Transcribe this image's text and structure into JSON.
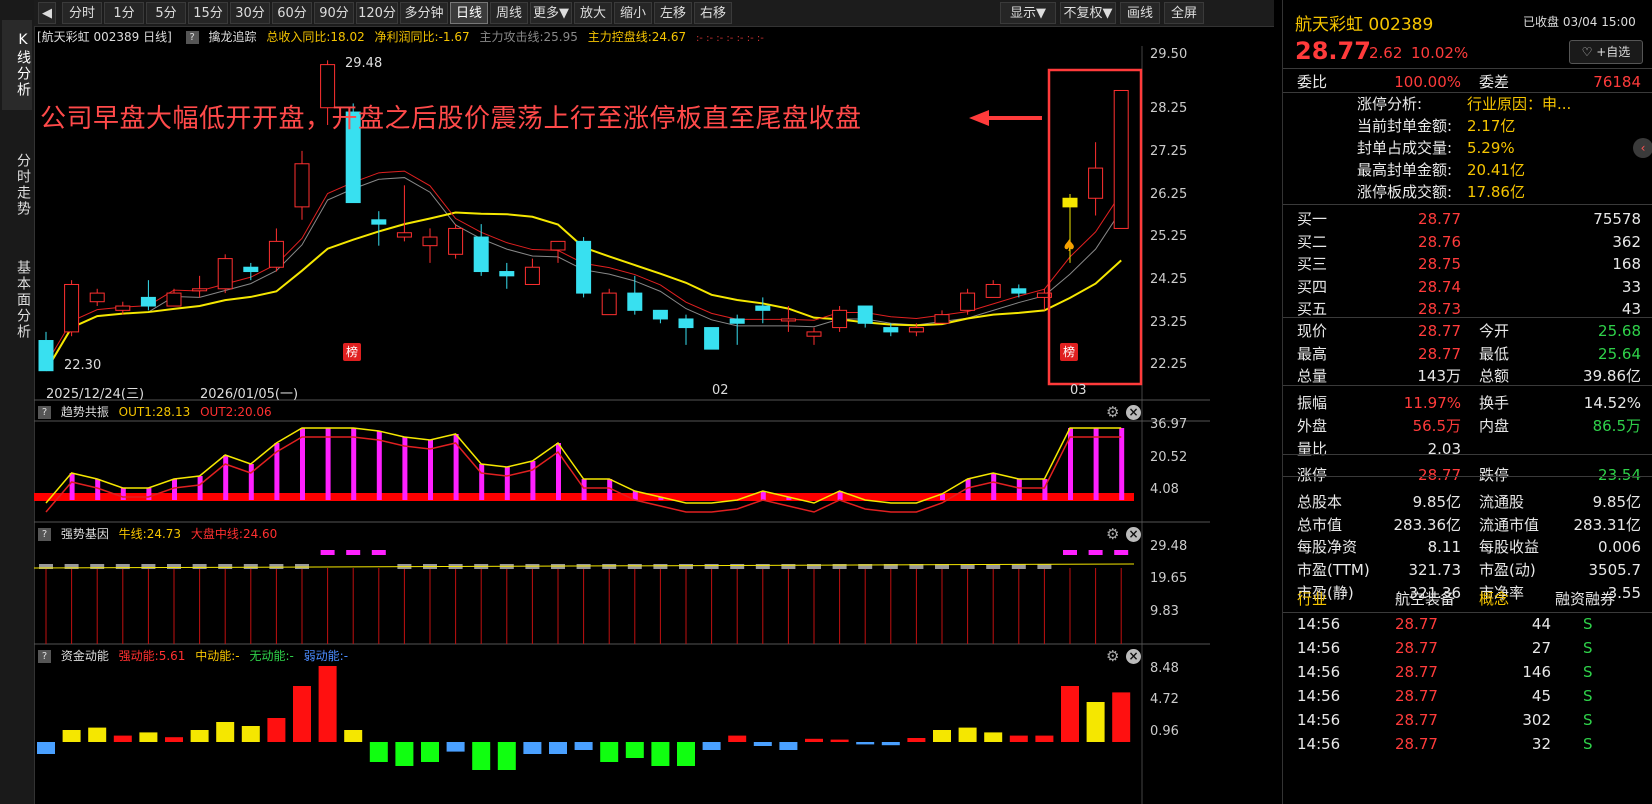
{
  "left_tabs": [
    "K线分析",
    "分时走势",
    "基本面分析"
  ],
  "toolbar": {
    "back_icon": "collapse-left-icon",
    "periods": [
      "分时",
      "1分",
      "5分",
      "15分",
      "30分",
      "60分",
      "90分",
      "120分",
      "多分钟",
      "日线",
      "周线",
      "更多▼",
      "放大",
      "缩小",
      "左移",
      "右移"
    ],
    "active_period": "日线",
    "right": [
      "显示▼",
      "不复权▼",
      "画线",
      "全屏"
    ]
  },
  "main_chart": {
    "title": "[航天彩虹 002389 日线]",
    "indicator_name": "擒龙追踪",
    "ind1": "总收入同比:18.02",
    "ind2": "净利润同比:-1.67",
    "ind3": "主力攻击线:25.95",
    "ind4": "主力控盘线:24.67",
    "ind_dots": ":-  :-  :-  :-  :-  :-  :-",
    "y_ticks": [
      "29.50",
      "28.25",
      "27.25",
      "26.25",
      "25.25",
      "24.25",
      "23.25",
      "22.25"
    ],
    "high_label": "29.48",
    "low_label": "22.30",
    "annotation": "公司早盘大幅低开开盘，开盘之后股价震荡上行至涨停板直至尾盘收盘",
    "badge": "榜",
    "x_labels": [
      "2025/12/24(三)",
      "2026/01/05(一)",
      "02",
      "03"
    ]
  },
  "panel2": {
    "name": "趋势共振",
    "out1": "OUT1:28.13",
    "out2": "OUT2:20.06",
    "y_ticks": [
      "36.97",
      "20.52",
      "4.08"
    ]
  },
  "panel3": {
    "name": "强势基因",
    "l1": "牛线:24.73",
    "l2": "大盘中线:24.60",
    "y_ticks": [
      "29.48",
      "19.65",
      "9.83"
    ]
  },
  "panel4": {
    "name": "资金动能",
    "l1": "强动能:5.61",
    "l2": "中动能:-",
    "l3": "无动能:-",
    "l4": "弱动能:-",
    "y_ticks": [
      "8.48",
      "4.72",
      "0.96"
    ]
  },
  "candles": [
    [
      23.0,
      22.3,
      22.9,
      23.2
    ],
    [
      23.2,
      24.3,
      23.1,
      24.4
    ],
    [
      23.9,
      24.1,
      23.8,
      24.2
    ],
    [
      23.7,
      23.8,
      23.6,
      23.9
    ],
    [
      24.0,
      23.8,
      23.7,
      24.4
    ],
    [
      23.8,
      24.1,
      23.8,
      24.2
    ],
    [
      24.2,
      24.2,
      24.0,
      24.5
    ],
    [
      24.2,
      24.9,
      24.1,
      25.0
    ],
    [
      24.7,
      24.6,
      24.4,
      24.8
    ],
    [
      24.7,
      25.3,
      24.6,
      25.6
    ],
    [
      26.1,
      27.1,
      25.8,
      27.4
    ],
    [
      28.4,
      29.4,
      28.0,
      29.5
    ],
    [
      28.3,
      26.2,
      26.2,
      28.5
    ],
    [
      25.8,
      25.7,
      25.2,
      26.0
    ],
    [
      25.4,
      25.5,
      25.3,
      26.6
    ],
    [
      25.2,
      25.4,
      24.8,
      25.6
    ],
    [
      25.0,
      25.6,
      24.9,
      25.7
    ],
    [
      25.4,
      24.6,
      24.5,
      25.7
    ],
    [
      24.6,
      24.5,
      24.2,
      24.8
    ],
    [
      24.3,
      24.7,
      24.3,
      24.9
    ],
    [
      25.1,
      25.3,
      24.8,
      25.3
    ],
    [
      25.3,
      24.1,
      24.0,
      25.4
    ],
    [
      23.6,
      24.1,
      23.6,
      24.2
    ],
    [
      24.1,
      23.7,
      23.6,
      24.5
    ],
    [
      23.7,
      23.5,
      23.4,
      23.7
    ],
    [
      23.5,
      23.3,
      22.9,
      23.6
    ],
    [
      23.3,
      22.8,
      22.8,
      23.3
    ],
    [
      23.5,
      23.4,
      22.9,
      23.6
    ],
    [
      23.8,
      23.7,
      23.4,
      24.0
    ],
    [
      23.5,
      23.5,
      23.2,
      23.8
    ],
    [
      23.1,
      23.2,
      22.9,
      23.3
    ],
    [
      23.3,
      23.7,
      23.2,
      23.8
    ],
    [
      23.8,
      23.4,
      23.3,
      23.8
    ],
    [
      23.3,
      23.2,
      23.1,
      23.4
    ],
    [
      23.2,
      23.3,
      23.1,
      23.4
    ],
    [
      23.4,
      23.6,
      23.4,
      23.7
    ],
    [
      23.7,
      24.1,
      23.6,
      24.2
    ],
    [
      24.0,
      24.3,
      24.0,
      24.4
    ],
    [
      24.2,
      24.1,
      24.0,
      24.3
    ],
    [
      24.0,
      24.1,
      23.7,
      24.2
    ],
    [
      26.3,
      26.1,
      24.8,
      26.4
    ],
    [
      26.3,
      27.0,
      25.9,
      27.6
    ],
    [
      25.6,
      28.8,
      25.6,
      28.8
    ]
  ],
  "right_panel": {
    "stock_name": "航天彩虹 002389",
    "status": "已收盘 03/04 15:00",
    "price": "28.77",
    "change": "2.62",
    "pct": "10.02%",
    "watch_btn": "♡ +自选",
    "weibi_label": "委比",
    "weibi": "100.00%",
    "weicha_label": "委差",
    "weicha": "76184",
    "limit_info": [
      [
        "涨停分析:",
        "行业原因：申..."
      ],
      [
        "当前封单金额:",
        "2.17亿"
      ],
      [
        "封单占成交量:",
        "5.29%"
      ],
      [
        "最高封单金额:",
        "20.41亿"
      ],
      [
        "涨停板成交额:",
        "17.86亿"
      ]
    ],
    "bids": [
      [
        "买一",
        "28.77",
        "75578"
      ],
      [
        "买二",
        "28.76",
        "362"
      ],
      [
        "买三",
        "28.75",
        "168"
      ],
      [
        "买四",
        "28.74",
        "33"
      ],
      [
        "买五",
        "28.73",
        "43"
      ]
    ],
    "stats": [
      [
        "现价",
        "28.77",
        "今开",
        "25.68"
      ],
      [
        "最高",
        "28.77",
        "最低",
        "25.64"
      ],
      [
        "总量",
        "143万",
        "总额",
        "39.86亿"
      ],
      [
        "振幅",
        "11.97%",
        "换手",
        "14.52%"
      ],
      [
        "外盘",
        "56.5万",
        "内盘",
        "86.5万"
      ],
      [
        "量比",
        "2.03",
        "",
        ""
      ],
      [
        "涨停",
        "28.77",
        "跌停",
        "23.54"
      ],
      [
        "总股本",
        "9.85亿",
        "流通股",
        "9.85亿"
      ],
      [
        "总市值",
        "283.36亿",
        "流通市值",
        "283.31亿"
      ],
      [
        "每股净资",
        "8.11",
        "每股收益",
        "0.006"
      ],
      [
        "市盈(TTM)",
        "321.73",
        "市盈(动)",
        "3505.7"
      ],
      [
        "市盈(静)",
        "321.36",
        "市净率",
        "3.55"
      ]
    ],
    "tags": [
      "行业",
      "航空装备",
      "概念",
      "融资融券"
    ],
    "ticks": [
      [
        "14:56",
        "28.77",
        "44",
        "S"
      ],
      [
        "14:56",
        "28.77",
        "27",
        "S"
      ],
      [
        "14:56",
        "28.77",
        "146",
        "S"
      ],
      [
        "14:56",
        "28.77",
        "45",
        "S"
      ],
      [
        "14:56",
        "28.77",
        "302",
        "S"
      ],
      [
        "14:56",
        "28.77",
        "32",
        "S"
      ]
    ]
  }
}
